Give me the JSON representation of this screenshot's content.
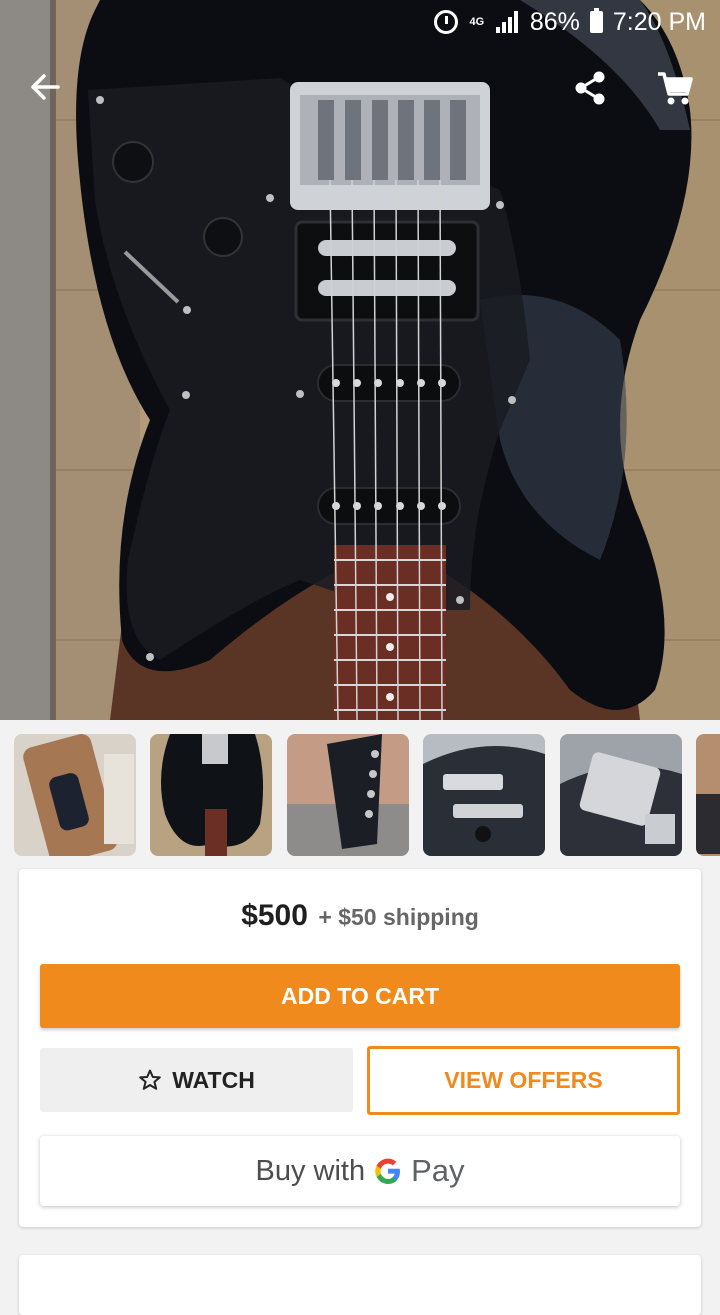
{
  "status_bar": {
    "battery_percent": "86%",
    "time": "7:20 PM",
    "network_label": "4G",
    "icons": [
      "alarm-icon",
      "network-icon",
      "signal-icon",
      "battery-icon"
    ]
  },
  "header": {
    "icons": [
      "back-arrow-icon",
      "share-icon",
      "cart-icon"
    ]
  },
  "gallery": {
    "selected_index": 1,
    "thumbnails": [
      "guitar-in-case",
      "guitar-body",
      "headstock",
      "pickup-closeup",
      "bridge-closeup",
      "partial-thumbnail"
    ]
  },
  "listing": {
    "price": "$500",
    "shipping": "+ $50 shipping",
    "add_to_cart_label": "ADD TO CART",
    "watch_label": "WATCH",
    "view_offers_label": "VIEW OFFERS",
    "gpay_prefix": "Buy with",
    "gpay_word": "Pay"
  },
  "colors": {
    "accent": "#f18a1c",
    "text_dark": "#1f1f1f"
  }
}
